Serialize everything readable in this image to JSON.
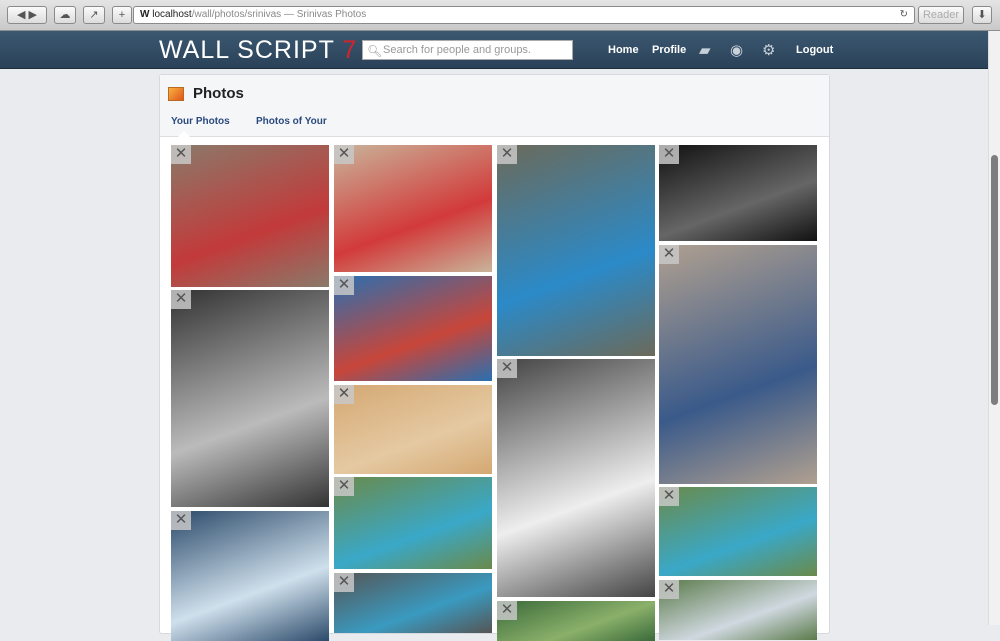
{
  "browser": {
    "url_host": "localhost",
    "url_path": "/wall/photos/srinivas",
    "page_title": " — Srinivas Photos",
    "reader": "Reader",
    "site_icon": "W"
  },
  "nav": {
    "logo": "WALL SCRIPT ",
    "logo_accent": "7",
    "search_placeholder": "Search for people and groups.",
    "home": "Home",
    "profile": "Profile",
    "logout": "Logout"
  },
  "page": {
    "title": "Photos",
    "tabs": [
      {
        "label": "Your Photos",
        "active": true
      },
      {
        "label": "Photos of Your",
        "active": false
      }
    ]
  },
  "photos": [
    {
      "col": 0,
      "colors": [
        "#8a7a6a",
        "#c23a3a"
      ]
    },
    {
      "col": 0,
      "colors": [
        "#333",
        "#bbb"
      ]
    },
    {
      "col": 0,
      "colors": [
        "#2b4a6a",
        "#cfe0ec"
      ]
    },
    {
      "col": 1,
      "colors": [
        "#c9b49a",
        "#d23a3a"
      ]
    },
    {
      "col": 1,
      "colors": [
        "#2a6fb0",
        "#c8463a"
      ]
    },
    {
      "col": 1,
      "colors": [
        "#d4a872",
        "#e5c9a2"
      ]
    },
    {
      "col": 1,
      "colors": [
        "#6a8a4a",
        "#3aa8c8"
      ]
    },
    {
      "col": 1,
      "colors": [
        "#555",
        "#3a9ac0"
      ]
    },
    {
      "col": 2,
      "colors": [
        "#6b6a5a",
        "#2b8ac8"
      ]
    },
    {
      "col": 2,
      "colors": [
        "#444",
        "#eee"
      ]
    },
    {
      "col": 2,
      "colors": [
        "#3a6a3a",
        "#8ab06a"
      ]
    },
    {
      "col": 3,
      "colors": [
        "#111",
        "#666"
      ]
    },
    {
      "col": 3,
      "colors": [
        "#b0a090",
        "#3a5a8a"
      ]
    },
    {
      "col": 3,
      "colors": [
        "#6a8a4a",
        "#3aa8c8"
      ]
    },
    {
      "col": 3,
      "colors": [
        "#5a7a4a",
        "#d0d8e0"
      ]
    }
  ]
}
